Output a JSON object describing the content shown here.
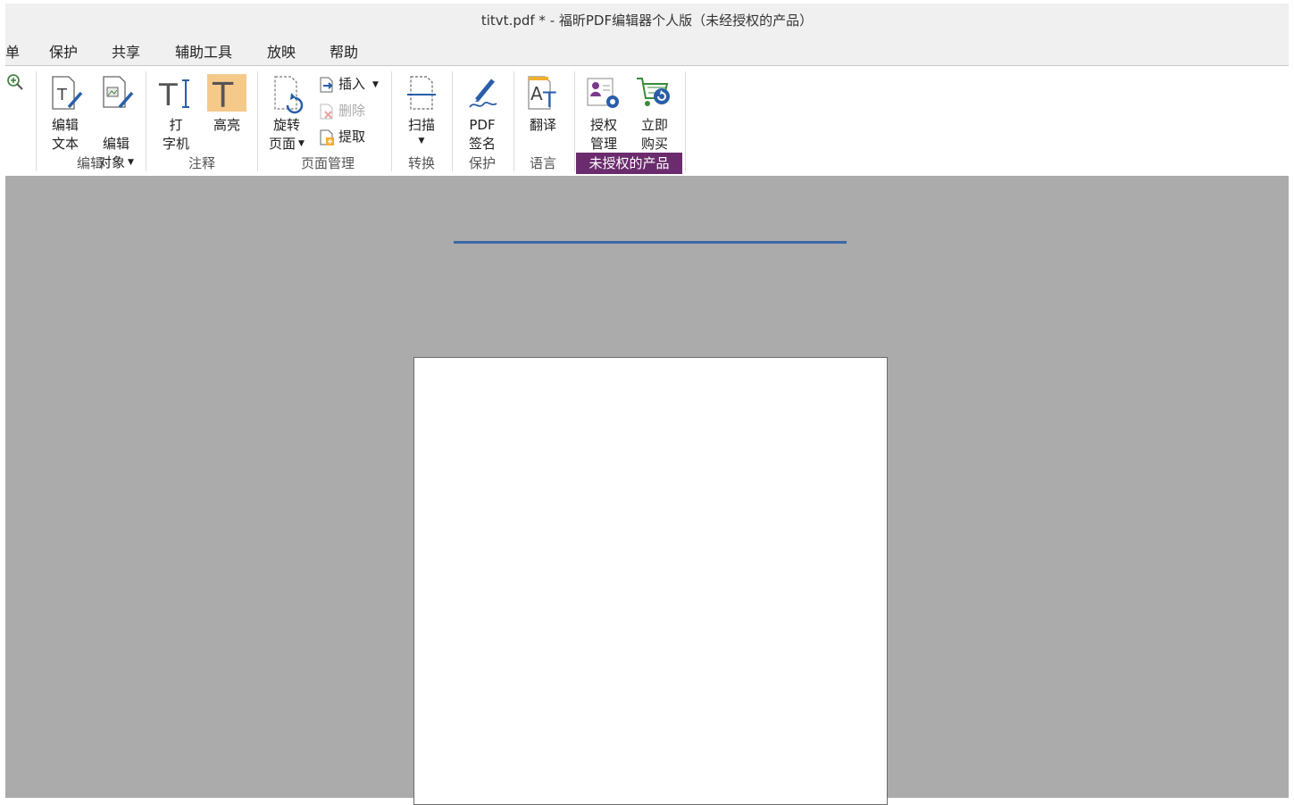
{
  "window": {
    "title": "titvt.pdf * - 福昕PDF编辑器个人版（未经授权的产品）"
  },
  "menu": {
    "items": [
      "单",
      "保护",
      "共享",
      "辅助工具",
      "放映",
      "帮助"
    ]
  },
  "ribbon": {
    "edit_group": {
      "label": "编辑",
      "edit_text": "编辑\n文本",
      "edit_object": "编辑\n对象"
    },
    "annotate_group": {
      "label": "注释",
      "typewriter": "打\n字机",
      "highlight": "高亮"
    },
    "page_group": {
      "label": "页面管理",
      "rotate": "旋转\n页面",
      "insert": "插入",
      "delete": "删除",
      "extract": "提取"
    },
    "convert_group": {
      "label": "转换",
      "scan": "扫描"
    },
    "protect_group": {
      "label": "保护",
      "pdf_sign": "PDF\n签名"
    },
    "language_group": {
      "label": "语言",
      "translate": "翻译"
    },
    "unlicensed_group": {
      "label": "未授权的产品",
      "license_manage": "授权\n管理",
      "buy_now": "立即\n购买"
    }
  },
  "colors": {
    "unlicensed_bg": "#6b2c6e",
    "highlight_active_bg": "#f5c98a",
    "document_bg": "#ababab",
    "accent_line": "#3b69a8"
  },
  "icons": {
    "zoom_in": "zoom-in-icon",
    "edit_text": "edit-text-icon",
    "edit_object": "edit-object-icon",
    "typewriter": "typewriter-icon",
    "highlight": "highlight-icon",
    "rotate": "rotate-page-icon",
    "insert": "insert-page-icon",
    "delete": "delete-page-icon",
    "extract": "extract-page-icon",
    "scan": "scan-icon",
    "sign": "pdf-sign-icon",
    "translate": "translate-icon",
    "license": "license-manage-icon",
    "buy": "shopping-cart-icon"
  }
}
